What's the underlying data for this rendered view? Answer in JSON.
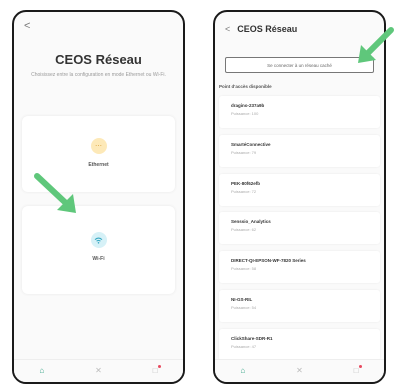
{
  "left_screen": {
    "back_icon": "chevron-left-icon",
    "title": "CEOS Réseau",
    "subtitle": "Choisissez entre la configuration en mode Ethernet ou Wi-Fi.",
    "options": [
      {
        "label": "Ethernet",
        "icon": "ethernet-icon",
        "color": "#fde9b8"
      },
      {
        "label": "Wi-Fi",
        "icon": "wifi-icon",
        "color": "#d6f1f7"
      }
    ]
  },
  "right_screen": {
    "back_icon": "chevron-left-icon",
    "title": "CEOS Réseau",
    "hidden_network_button": "Se connecter à un réseau caché",
    "section_title": "Point d'accès disponible",
    "networks": [
      {
        "name": "dragino-237a9b",
        "power": "Puissance: 100"
      },
      {
        "name": "SmartéConnective",
        "power": "Puissance: 79"
      },
      {
        "name": "PEK-80f62efb",
        "power": "Puissance: 72"
      },
      {
        "name": "Senssio_Analytics",
        "power": "Puissance: 62"
      },
      {
        "name": "DIRECT-QI-EPSON-WF-7820 Series",
        "power": "Puissance: 58"
      },
      {
        "name": "NI-GS-RIL",
        "power": "Puissance: 54"
      },
      {
        "name": "ClickShare-SDR-R1",
        "power": "Puissance: 47"
      }
    ]
  },
  "bottom_nav": {
    "items": [
      {
        "name": "home",
        "icon": "home-icon",
        "active": true
      },
      {
        "name": "tools",
        "icon": "tools-icon",
        "active": false
      },
      {
        "name": "notifications",
        "icon": "bell-icon",
        "active": false
      }
    ]
  },
  "colors": {
    "arrow": "#5fc77b",
    "active_nav": "#3aa58a",
    "notification_dot": "#e84a5f"
  }
}
